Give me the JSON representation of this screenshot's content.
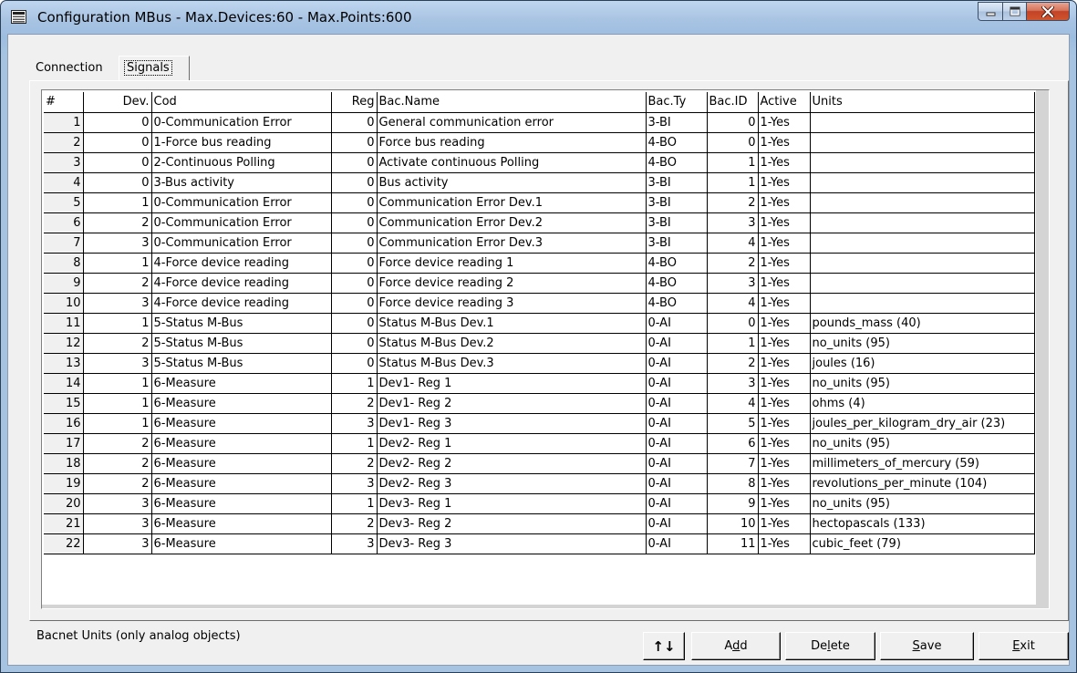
{
  "window": {
    "title": "Configuration MBus - Max.Devices:60 - Max.Points:600"
  },
  "tabs": [
    {
      "label": "Connection"
    },
    {
      "label": "Signals"
    }
  ],
  "grid": {
    "columns": [
      "#",
      "Dev.",
      "Cod",
      "Reg",
      "Bac.Name",
      "Bac.Ty",
      "Bac.ID",
      "Active",
      "Units"
    ],
    "rows": [
      [
        "1",
        "0",
        "0-Communication Error",
        "0",
        "General communication error",
        "3-BI",
        "0",
        "1-Yes",
        ""
      ],
      [
        "2",
        "0",
        "1-Force bus reading",
        "0",
        "Force bus reading",
        "4-BO",
        "0",
        "1-Yes",
        ""
      ],
      [
        "3",
        "0",
        "2-Continuous Polling",
        "0",
        "Activate continuous Polling",
        "4-BO",
        "1",
        "1-Yes",
        ""
      ],
      [
        "4",
        "0",
        "3-Bus activity",
        "0",
        "Bus activity",
        "3-BI",
        "1",
        "1-Yes",
        ""
      ],
      [
        "5",
        "1",
        "0-Communication Error",
        "0",
        "Communication Error Dev.1",
        "3-BI",
        "2",
        "1-Yes",
        ""
      ],
      [
        "6",
        "2",
        "0-Communication Error",
        "0",
        "Communication Error Dev.2",
        "3-BI",
        "3",
        "1-Yes",
        ""
      ],
      [
        "7",
        "3",
        "0-Communication Error",
        "0",
        "Communication Error Dev.3",
        "3-BI",
        "4",
        "1-Yes",
        ""
      ],
      [
        "8",
        "1",
        "4-Force device reading",
        "0",
        "Force device reading 1",
        "4-BO",
        "2",
        "1-Yes",
        ""
      ],
      [
        "9",
        "2",
        "4-Force device reading",
        "0",
        "Force device reading 2",
        "4-BO",
        "3",
        "1-Yes",
        ""
      ],
      [
        "10",
        "3",
        "4-Force device reading",
        "0",
        "Force device reading 3",
        "4-BO",
        "4",
        "1-Yes",
        ""
      ],
      [
        "11",
        "1",
        "5-Status M-Bus",
        "0",
        "Status M-Bus Dev.1",
        "0-AI",
        "0",
        "1-Yes",
        "pounds_mass (40)"
      ],
      [
        "12",
        "2",
        "5-Status M-Bus",
        "0",
        "Status M-Bus Dev.2",
        "0-AI",
        "1",
        "1-Yes",
        "no_units (95)"
      ],
      [
        "13",
        "3",
        "5-Status M-Bus",
        "0",
        "Status M-Bus Dev.3",
        "0-AI",
        "2",
        "1-Yes",
        "joules (16)"
      ],
      [
        "14",
        "1",
        "6-Measure",
        "1",
        "Dev1- Reg 1",
        "0-AI",
        "3",
        "1-Yes",
        "no_units (95)"
      ],
      [
        "15",
        "1",
        "6-Measure",
        "2",
        "Dev1- Reg 2",
        "0-AI",
        "4",
        "1-Yes",
        "ohms (4)"
      ],
      [
        "16",
        "1",
        "6-Measure",
        "3",
        "Dev1- Reg 3",
        "0-AI",
        "5",
        "1-Yes",
        "joules_per_kilogram_dry_air (23)"
      ],
      [
        "17",
        "2",
        "6-Measure",
        "1",
        "Dev2- Reg 1",
        "0-AI",
        "6",
        "1-Yes",
        "no_units (95)"
      ],
      [
        "18",
        "2",
        "6-Measure",
        "2",
        "Dev2- Reg 2",
        "0-AI",
        "7",
        "1-Yes",
        "millimeters_of_mercury (59)"
      ],
      [
        "19",
        "2",
        "6-Measure",
        "3",
        "Dev2- Reg 3",
        "0-AI",
        "8",
        "1-Yes",
        "revolutions_per_minute (104)"
      ],
      [
        "20",
        "3",
        "6-Measure",
        "1",
        "Dev3- Reg 1",
        "0-AI",
        "9",
        "1-Yes",
        "no_units (95)"
      ],
      [
        "21",
        "3",
        "6-Measure",
        "2",
        "Dev3- Reg 2",
        "0-AI",
        "10",
        "1-Yes",
        "hectopascals (133)"
      ],
      [
        "22",
        "3",
        "6-Measure",
        "3",
        "Dev3- Reg 3",
        "0-AI",
        "11",
        "1-Yes",
        "cubic_feet (79)"
      ]
    ]
  },
  "status": {
    "text": "Bacnet Units (only analog objects)"
  },
  "buttons": {
    "arrows": "↑↓",
    "add_prefix": "A",
    "add_ul": "d",
    "add_suffix": "d",
    "delete_prefix": "De",
    "delete_ul": "l",
    "delete_suffix": "ete",
    "save_ul": "S",
    "save_suffix": "ave",
    "exit_ul": "E",
    "exit_suffix": "xit"
  }
}
